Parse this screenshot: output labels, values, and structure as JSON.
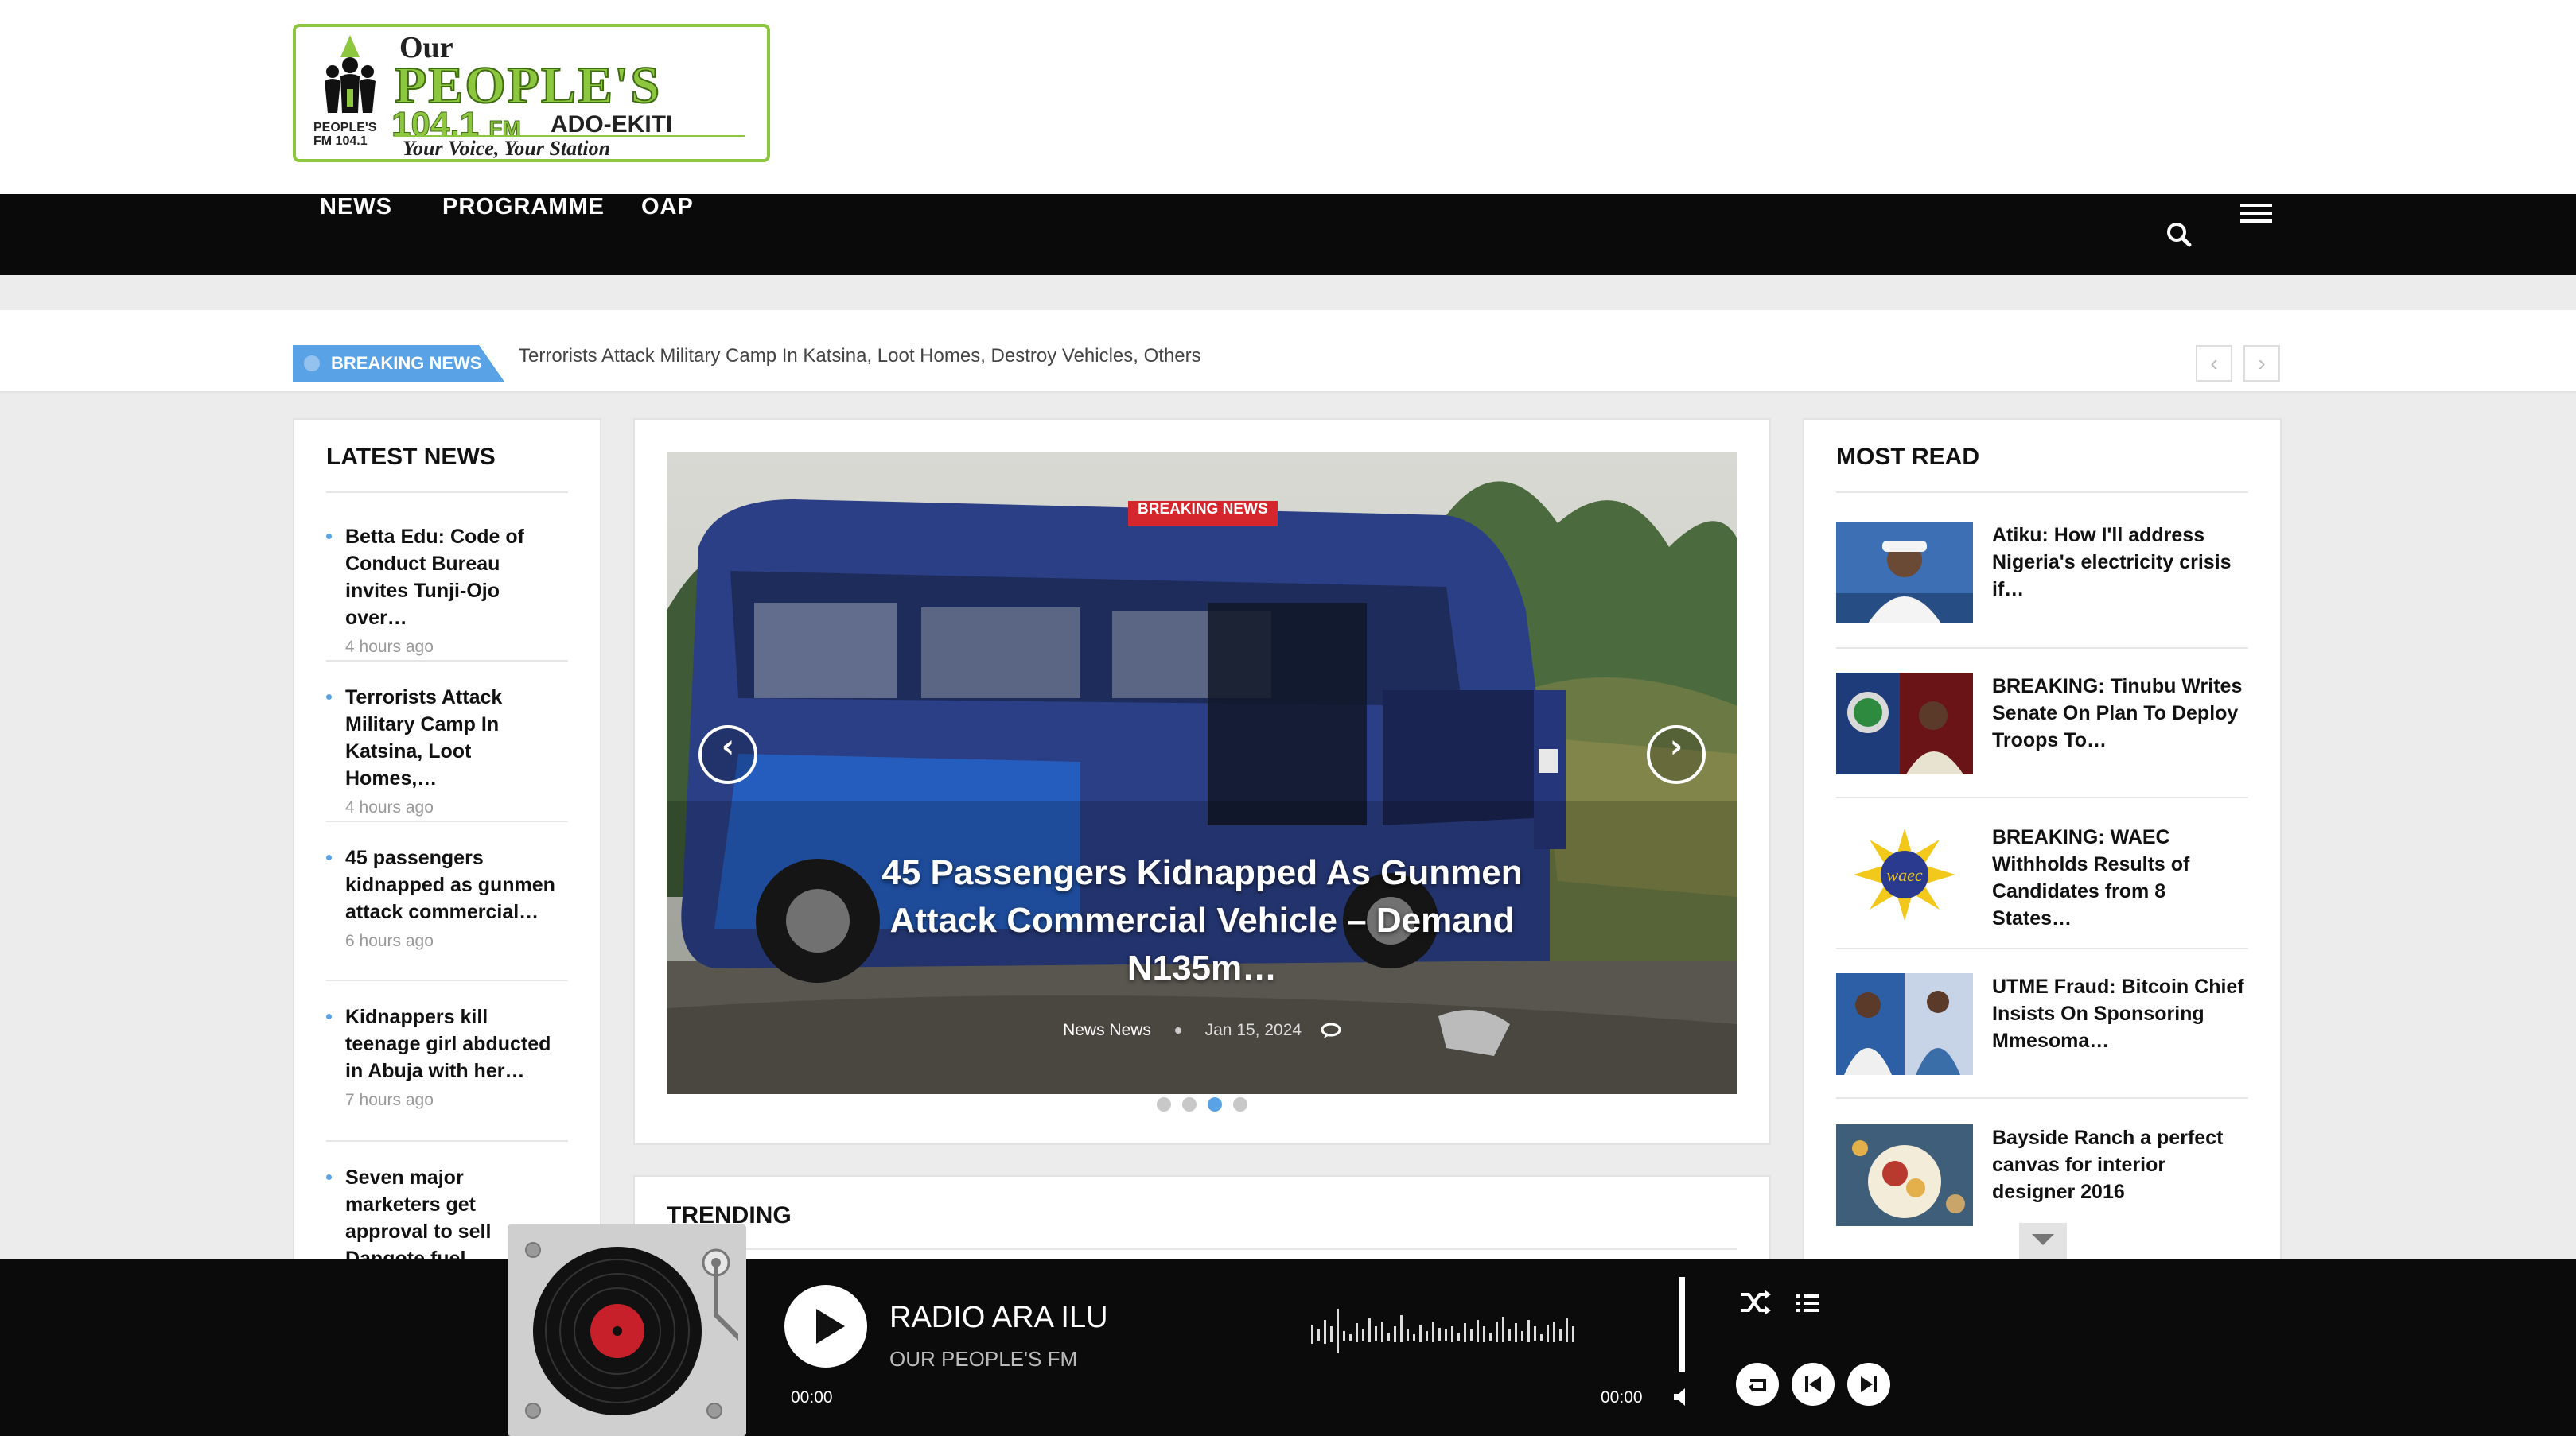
{
  "logo": {
    "our": "Our",
    "name": "PEOPLE'S",
    "frequency": "104.1",
    "band": "FM",
    "city": "ADO-EKITI",
    "slogan": "Your Voice, Your Station",
    "mini_brand": "PEOPLE'S FM 104.1"
  },
  "nav": {
    "items": [
      {
        "label": "NEWS"
      },
      {
        "label": "PROGRAMME"
      },
      {
        "label": "OAP"
      }
    ],
    "search_icon": "search-icon",
    "menu_icon": "hamburger-menu-icon"
  },
  "ticker": {
    "label": "BREAKING NEWS",
    "headline": "Terrorists Attack Military Camp In Katsina, Loot Homes, Destroy Vehicles, Others",
    "prev": "‹",
    "next": "›"
  },
  "latest_news": {
    "title": "LATEST NEWS",
    "items": [
      {
        "title": "Betta Edu: Code of Conduct Bureau invites Tunji-Ojo over…",
        "time": "4 hours ago"
      },
      {
        "title": "Terrorists Attack Military Camp In Katsina, Loot Homes,…",
        "time": "4 hours ago"
      },
      {
        "title": "45 passengers kidnapped as gunmen attack commercial…",
        "time": "6 hours ago"
      },
      {
        "title": "Kidnappers kill teenage girl abducted in Abuja with her…",
        "time": "7 hours ago"
      },
      {
        "title": "Seven major marketers get approval to sell Dangote fuel",
        "time": ""
      }
    ]
  },
  "slider": {
    "badge": "BREAKING NEWS",
    "title": "45 Passengers Kidnapped As Gunmen Attack Commercial Vehicle – Demand N135m…",
    "category": "News News",
    "date": "Jan 15, 2024",
    "prev_icon": "chevron-left-icon",
    "next_icon": "chevron-right-icon",
    "active_dot": 3,
    "dot_count": 4
  },
  "trending": {
    "title": "TRENDING"
  },
  "most_read": {
    "title": "MOST READ",
    "items": [
      {
        "title": "Atiku: How I'll address Nigeria's electricity crisis if…"
      },
      {
        "title": "BREAKING: Tinubu Writes Senate On Plan To Deploy Troops To…"
      },
      {
        "title": "BREAKING: WAEC Withholds Results of Candidates from 8 States…"
      },
      {
        "title": "UTME Fraud: Bitcoin Chief Insists On Sponsoring Mmesoma…"
      },
      {
        "title": "Bayside Ranch a perfect canvas for interior designer 2016"
      }
    ],
    "waec_badge": "waec"
  },
  "player": {
    "station": "RADIO ARA ILU",
    "subtitle": "OUR PEOPLE'S FM",
    "time_elapsed": "00:00",
    "time_total": "00:00",
    "colors": {
      "accent": "#5aa2e6",
      "brand_green": "#8dc63f",
      "badge_red": "#d5262e"
    }
  }
}
